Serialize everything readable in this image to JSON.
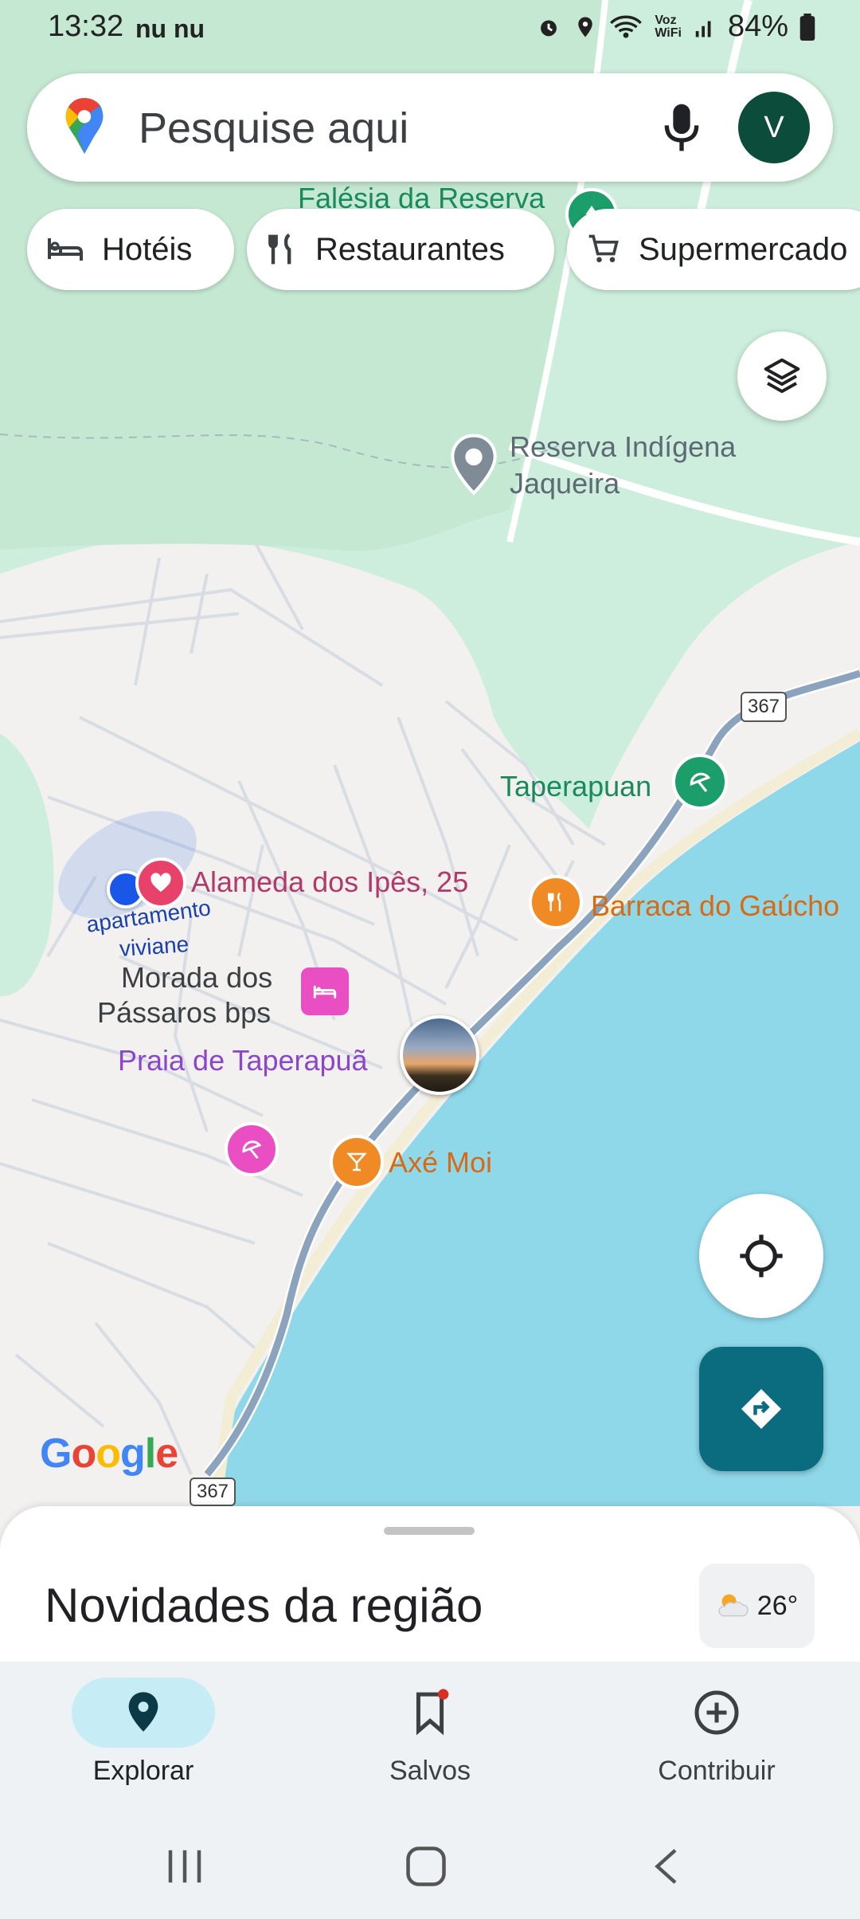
{
  "status_bar": {
    "time": "13:32",
    "carrier_icons": "nu nu",
    "battery": "84%"
  },
  "search": {
    "placeholder": "Pesquise aqui",
    "avatar_initial": "V"
  },
  "chips": [
    {
      "label": "Hotéis",
      "icon": "hotel-bed-icon"
    },
    {
      "label": "Restaurantes",
      "icon": "fork-knife-icon"
    },
    {
      "label": "Supermercado",
      "icon": "shopping-cart-icon"
    }
  ],
  "map": {
    "labels": {
      "falesia": "Falésia da Reserva",
      "reserva_line1": "Reserva Indígena",
      "reserva_line2": "Jaqueira",
      "taperapuan": "Taperapuan",
      "alameda": "Alameda dos Ipês, 25",
      "apartamento_line1": "apartamento",
      "apartamento_line2": "viviane",
      "morada_line1": "Morada dos",
      "morada_line2": "Pássaros bps",
      "barraca": "Barraca do Gaúcho",
      "praia": "Praia de Taperapuã",
      "axe": "Axé Moi",
      "road_top": "367",
      "road_bottom": "367",
      "google_logo": "Google"
    },
    "colors": {
      "water": "#8fd8ea",
      "park": "#cdeedc",
      "land": "#f2f1ef",
      "road_highway": "#8ba3bd",
      "restaurant": "#f08a24",
      "hotel": "#e94ec2",
      "favorite": "#e8416a",
      "location_dot": "#1a57e8",
      "directions": "#0a6c7e"
    }
  },
  "sheet": {
    "title": "Novidades da região",
    "temperature": "26°"
  },
  "bottom_nav": [
    {
      "label": "Explorar",
      "icon": "explore-pin-icon",
      "active": true
    },
    {
      "label": "Salvos",
      "icon": "bookmark-icon",
      "active": false
    },
    {
      "label": "Contribuir",
      "icon": "add-circle-icon",
      "active": false
    }
  ]
}
